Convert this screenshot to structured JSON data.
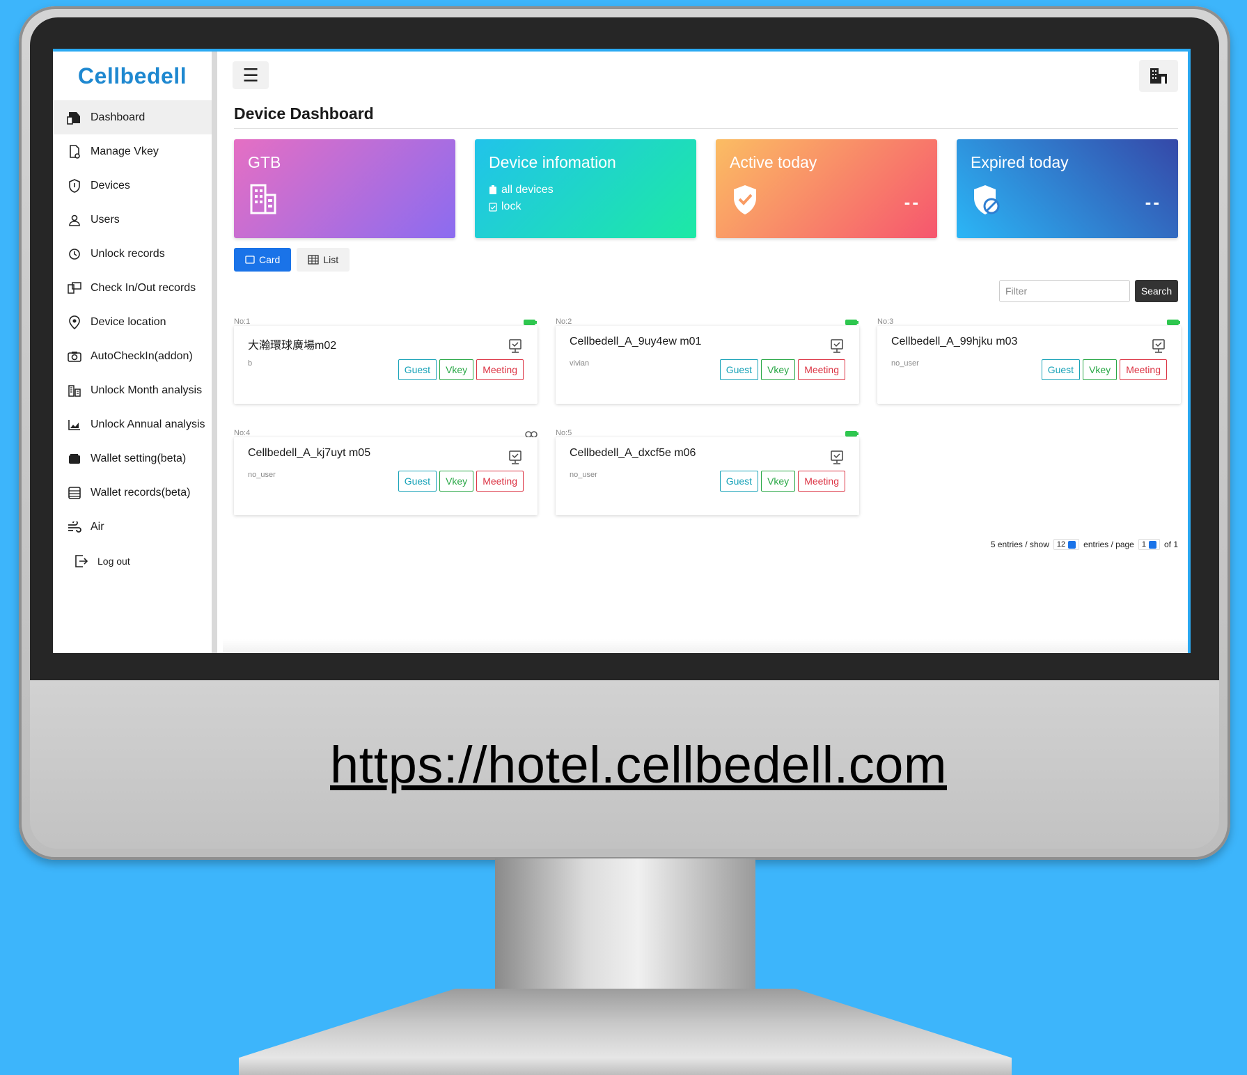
{
  "brand": "Cellbedell",
  "sidebar": {
    "items": [
      {
        "label": "Dashboard",
        "icon": "dashboard-icon"
      },
      {
        "label": "Manage Vkey",
        "icon": "key-icon"
      },
      {
        "label": "Devices",
        "icon": "shield-icon"
      },
      {
        "label": "Users",
        "icon": "user-icon"
      },
      {
        "label": "Unlock records",
        "icon": "history-icon"
      },
      {
        "label": "Check In/Out records",
        "icon": "checkin-icon"
      },
      {
        "label": "Device location",
        "icon": "location-pin-icon"
      },
      {
        "label": "AutoCheckIn(addon)",
        "icon": "camera-icon"
      },
      {
        "label": "Unlock Month analysis",
        "icon": "building-chart-icon"
      },
      {
        "label": "Unlock Annual analysis",
        "icon": "area-chart-icon"
      },
      {
        "label": "Wallet setting(beta)",
        "icon": "wallet-icon"
      },
      {
        "label": "Wallet records(beta)",
        "icon": "list-icon"
      },
      {
        "label": "Air",
        "icon": "wind-icon"
      }
    ],
    "logout": "Log out"
  },
  "page_title": "Device Dashboard",
  "stats": {
    "gtb": {
      "title": "GTB"
    },
    "device_info": {
      "title": "Device infomation",
      "line1": "all devices",
      "line2": "lock"
    },
    "active_today": {
      "title": "Active today",
      "value": "--"
    },
    "expired_today": {
      "title": "Expired today",
      "value": "--"
    }
  },
  "view_toggle": {
    "card": "Card",
    "list": "List"
  },
  "filter": {
    "placeholder": "Filter",
    "search": "Search"
  },
  "tags": {
    "guest": "Guest",
    "vkey": "Vkey",
    "meeting": "Meeting"
  },
  "devices": [
    {
      "no": "No:1",
      "name": "大瀚環球廣場m02",
      "user": "b",
      "status": "battery"
    },
    {
      "no": "No:2",
      "name": "Cellbedell_A_9uy4ew m01",
      "user": "vivian",
      "status": "battery"
    },
    {
      "no": "No:3",
      "name": "Cellbedell_A_99hjku m03",
      "user": "no_user",
      "status": "battery"
    },
    {
      "no": "No:4",
      "name": "Cellbedell_A_kj7uyt m05",
      "user": "no_user",
      "status": "link"
    },
    {
      "no": "No:5",
      "name": "Cellbedell_A_dxcf5e m06",
      "user": "no_user",
      "status": "battery"
    }
  ],
  "pager": {
    "entries": "5 entries / show",
    "show_value": "12",
    "per_page": "entries / page",
    "page_value": "1",
    "of": "of 1"
  },
  "url": "https://hotel.cellbedell.com",
  "colors": {
    "background": "#3db5fb",
    "brand": "#1e88d0",
    "primary": "#1a73e8"
  }
}
